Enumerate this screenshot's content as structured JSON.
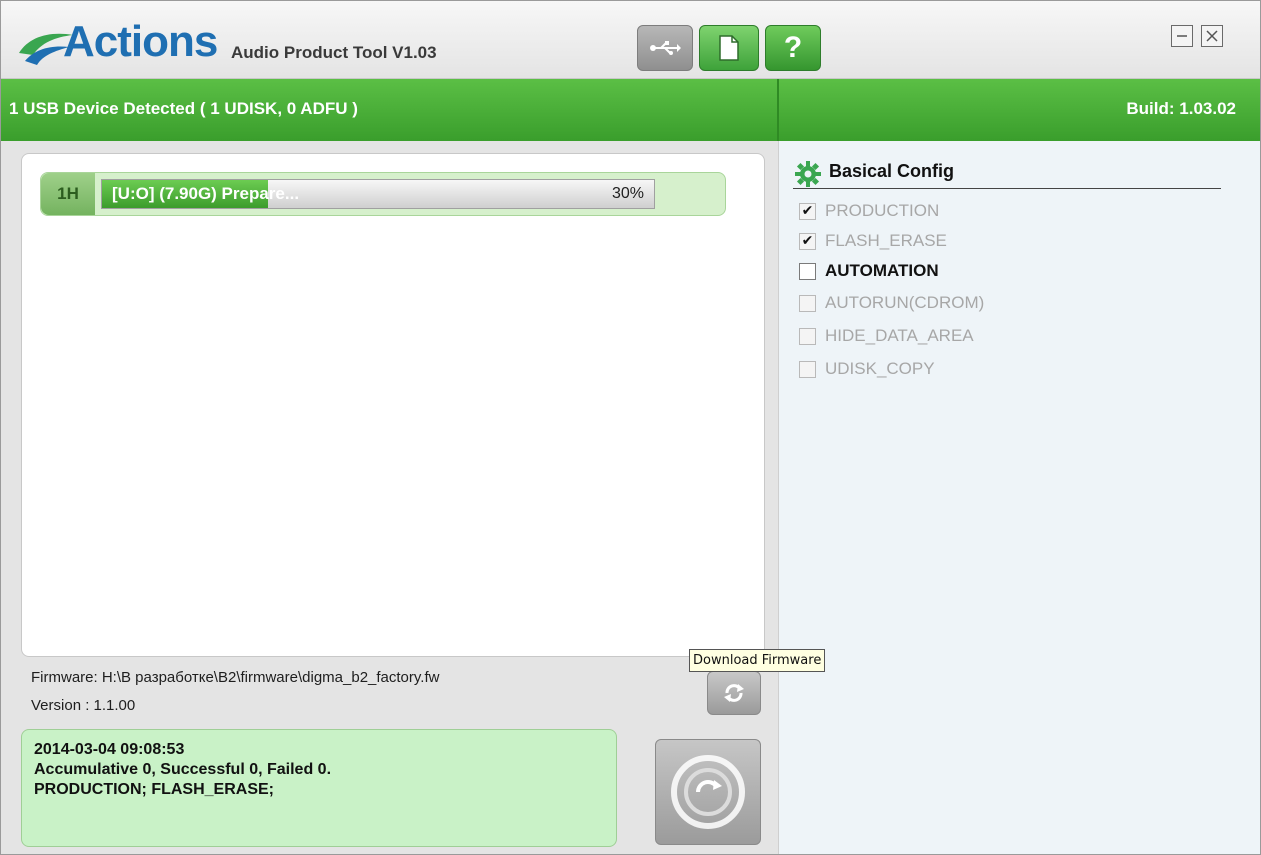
{
  "app": {
    "brand": "Actions",
    "subtitle": "Audio Product Tool V1.03"
  },
  "toolbar": {
    "usb_icon": "usb-icon",
    "file_icon": "document-icon",
    "help_label": "?"
  },
  "status": {
    "devices": "1 USB Device Detected ( 1 UDISK, 0 ADFU )",
    "build": "Build: 1.03.02"
  },
  "device": {
    "id": "1H",
    "label": "[U:O] (7.90G) Prepare...",
    "progress_pct": 30,
    "progress_text": "30%"
  },
  "firmware": {
    "path": "Firmware: H:\\В разработке\\B2\\firmware\\digma_b2_factory.fw",
    "version": "Version : 1.1.00"
  },
  "log": {
    "line1": "2014-03-04 09:08:53",
    "line2": "Accumulative 0, Successful 0, Failed 0.",
    "line3": "PRODUCTION; FLASH_ERASE;"
  },
  "tooltip": {
    "text": "Download Firmware"
  },
  "config": {
    "title": "Basical Config",
    "options": [
      {
        "label": "PRODUCTION",
        "checked": true,
        "enabled": false
      },
      {
        "label": "FLASH_ERASE",
        "checked": true,
        "enabled": false
      },
      {
        "label": "AUTOMATION",
        "checked": false,
        "enabled": true
      },
      {
        "label": "AUTORUN(CDROM)",
        "checked": false,
        "enabled": false
      },
      {
        "label": "HIDE_DATA_AREA",
        "checked": false,
        "enabled": false
      },
      {
        "label": "UDISK_COPY",
        "checked": false,
        "enabled": false
      }
    ]
  },
  "colors": {
    "accent_green": "#3a9e2c",
    "brand_blue": "#1f6fb2",
    "log_bg": "#c9f2c7"
  }
}
